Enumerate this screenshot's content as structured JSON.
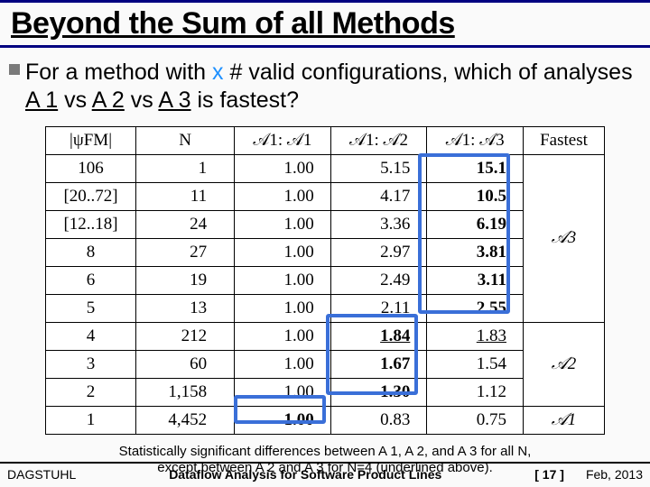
{
  "title": "Beyond the Sum of all Methods",
  "body": {
    "pre": "For a method with ",
    "x": "x",
    "mid1": " # valid configurations, which of analyses ",
    "a1": "A 1",
    "vs1": " vs ",
    "a2": "A 2",
    "vs2": " vs ",
    "a3": "A 3",
    "tail": " is fastest?"
  },
  "headers": {
    "psi": "|ψFM|",
    "n": "N",
    "c1": "𝒜1: 𝒜1",
    "c2": "𝒜1: 𝒜2",
    "c3": "𝒜1: 𝒜3",
    "fastest": "Fastest"
  },
  "rows": [
    {
      "psi": "106",
      "n": "1",
      "r1": "1.00",
      "r2": "5.15",
      "r3": "15.1",
      "r3b": true
    },
    {
      "psi": "[20..72]",
      "n": "11",
      "r1": "1.00",
      "r2": "4.17",
      "r3": "10.5",
      "r3b": true
    },
    {
      "psi": "[12..18]",
      "n": "24",
      "r1": "1.00",
      "r2": "3.36",
      "r3": "6.19",
      "r3b": true
    },
    {
      "psi": "8",
      "n": "27",
      "r1": "1.00",
      "r2": "2.97",
      "r3": "3.81",
      "r3b": true
    },
    {
      "psi": "6",
      "n": "19",
      "r1": "1.00",
      "r2": "2.49",
      "r3": "3.11",
      "r3b": true
    },
    {
      "psi": "5",
      "n": "13",
      "r1": "1.00",
      "r2": "2.11",
      "r3": "2.55",
      "r3b": true
    },
    {
      "psi": "4",
      "n": "212",
      "r1": "1.00",
      "r2": "1.84",
      "r2b": true,
      "r2u": true,
      "r3": "1.83",
      "r3u": true
    },
    {
      "psi": "3",
      "n": "60",
      "r1": "1.00",
      "r2": "1.67",
      "r2b": true,
      "r3": "1.54"
    },
    {
      "psi": "2",
      "n": "1,158",
      "r1": "1.00",
      "r2": "1.30",
      "r2b": true,
      "r3": "1.12"
    },
    {
      "psi": "1",
      "n": "4,452",
      "r1": "1.00",
      "r1b": true,
      "r2": "0.83",
      "r3": "0.75"
    }
  ],
  "fastest": {
    "g1": "𝒜3",
    "g2": "𝒜2",
    "g3": "𝒜1"
  },
  "caption": {
    "l1": "Statistically significant differences between A 1, A 2, and A 3 for all N,",
    "l2": "except between A 2 and A 3 for N=4 (underlined above)."
  },
  "footer": {
    "venue": "DAGSTUHL",
    "mid": "Dataflow Analysis for Software Product Lines",
    "page": "[ 17 ]",
    "date": "Feb, 2013"
  }
}
